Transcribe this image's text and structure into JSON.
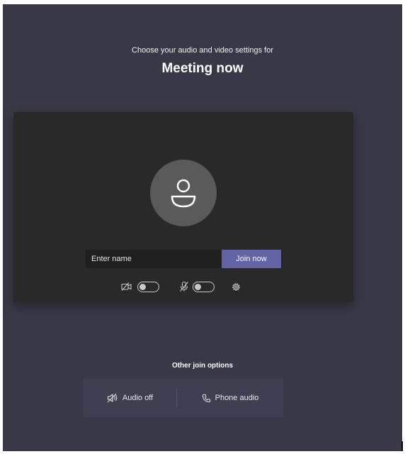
{
  "header": {
    "subtitle": "Choose your audio and video settings for",
    "meeting_title": "Meeting now"
  },
  "prejoin": {
    "name_placeholder": "Enter name",
    "join_label": "Join now",
    "video_toggle": {
      "icon": "camera-off-icon",
      "on": false
    },
    "mic_toggle": {
      "icon": "mic-off-icon",
      "on": false
    },
    "settings_icon": "gear-icon"
  },
  "other_options": {
    "label": "Other join options",
    "items": [
      {
        "icon": "speaker-off-icon",
        "label": "Audio off"
      },
      {
        "icon": "phone-icon",
        "label": "Phone audio"
      }
    ]
  },
  "colors": {
    "background": "#393848",
    "panel": "#292929",
    "accent": "#6264a7"
  }
}
